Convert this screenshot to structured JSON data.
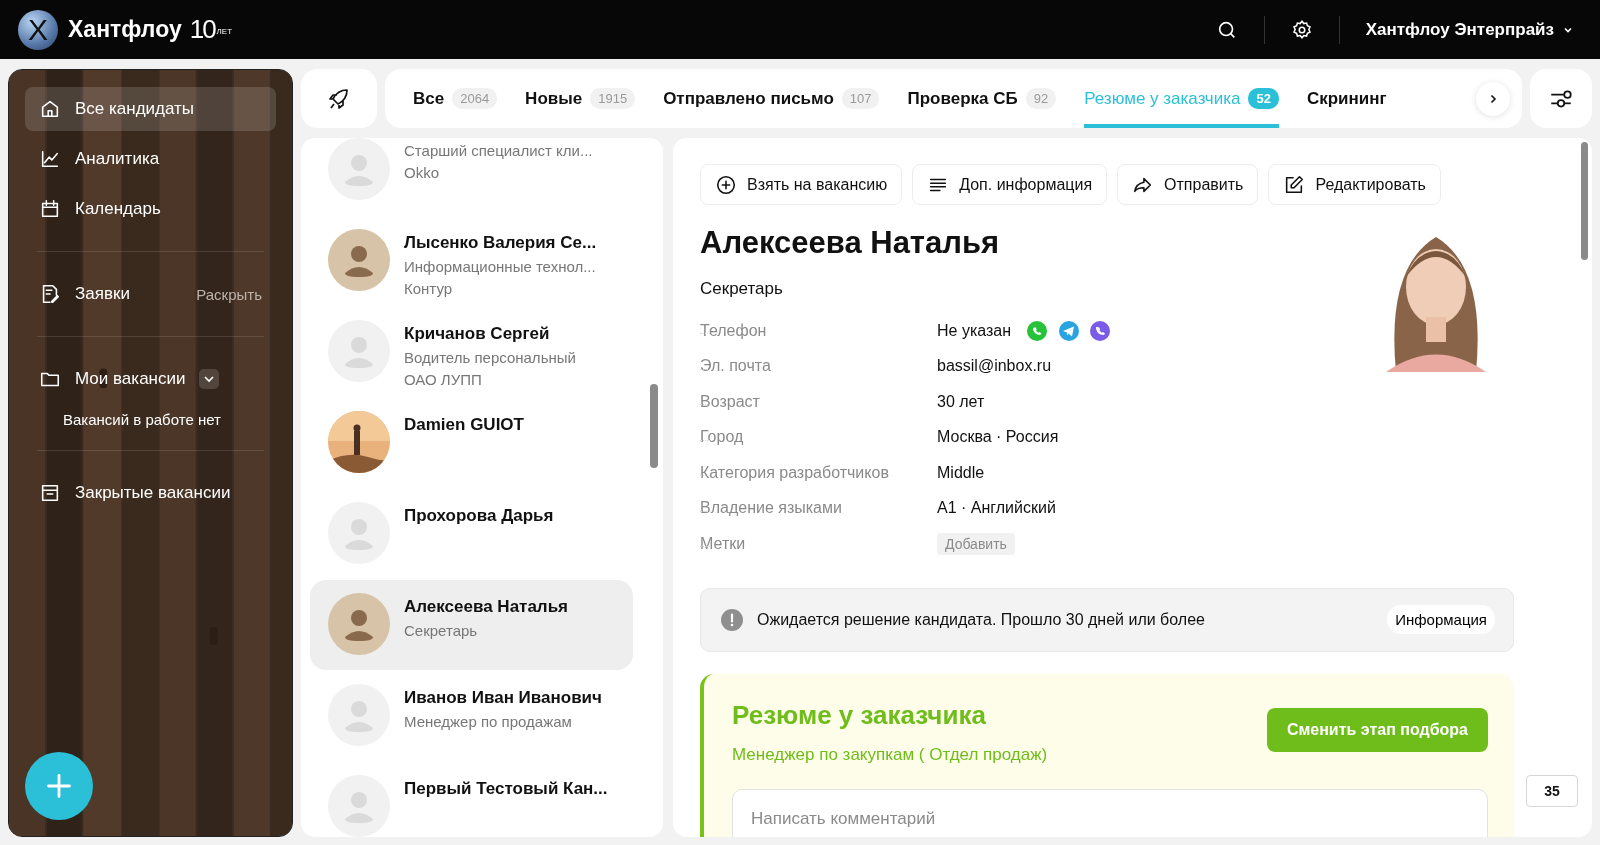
{
  "header": {
    "logo_mark": "X",
    "logo": "Хантфлоу",
    "anniversary_number": "10",
    "anniversary_word": "ЛЕТ",
    "account": "Хантфлоу Энтерпрайз"
  },
  "sidebar": {
    "items": [
      {
        "kind": "nav",
        "label": "Все кандидаты",
        "selected": true
      },
      {
        "kind": "nav",
        "label": "Аналитика",
        "selected": false
      },
      {
        "kind": "nav",
        "label": "Календарь",
        "selected": false
      },
      {
        "kind": "divider"
      },
      {
        "kind": "expandable",
        "label": "Заявки",
        "action": "Раскрыть",
        "selected": false
      },
      {
        "kind": "divider"
      },
      {
        "kind": "dropdown",
        "label": "Мои вакансии",
        "note": "Вакансий в работе нет",
        "selected": false
      },
      {
        "kind": "divider"
      },
      {
        "kind": "nav",
        "label": "Закрытые вакансии",
        "selected": false
      }
    ]
  },
  "tabs": [
    {
      "label": "Все",
      "count": "2064",
      "selected": false
    },
    {
      "label": "Новые",
      "count": "1915",
      "selected": false
    },
    {
      "label": "Отправлено письмо",
      "count": "107",
      "selected": false
    },
    {
      "label": "Проверка СБ",
      "count": "92",
      "selected": false
    },
    {
      "label": "Резюме у заказчика",
      "count": "52",
      "selected": true
    },
    {
      "label": "Скрининг",
      "selected": false
    }
  ],
  "candidates": [
    {
      "kind": "placeholder",
      "lines": [
        "Старший специалист кли...",
        "Okko"
      ],
      "selected": false
    },
    {
      "name": "Лысенко Валерия Се...",
      "lines": [
        "Информационные технол...",
        "Контур"
      ],
      "selected": false
    },
    {
      "kind": "placeholder",
      "name": "Кричанов Сергей",
      "lines": [
        "Водитель персональный",
        "ОАО ЛУПП"
      ],
      "selected": false
    },
    {
      "kind": "picture",
      "name": "Damien GUIOT",
      "selected": false
    },
    {
      "kind": "placeholder",
      "name": "Прохорова Дарья",
      "selected": false
    },
    {
      "name": "Алексеева Наталья",
      "lines": [
        "Секретарь"
      ],
      "selected": true
    },
    {
      "kind": "placeholder",
      "name": "Иванов Иван Иванович",
      "lines": [
        "Менеджер по продажам"
      ],
      "selected": false
    },
    {
      "kind": "placeholder",
      "name": "Первый Тестовый Кан...",
      "selected": false
    }
  ],
  "profile": {
    "actions": [
      "Взять на вакансию",
      "Доп. информация",
      "Отправить",
      "Редактировать"
    ],
    "name": "Алексеева Наталья",
    "position": "Секретарь",
    "fields": [
      {
        "kind": "phone",
        "label": "Телефон",
        "value": "Не указан"
      },
      {
        "kind": "text",
        "label": "Эл. почта",
        "value": "bassil@inbox.ru"
      },
      {
        "kind": "text",
        "label": "Возраст",
        "value": "30 лет"
      },
      {
        "kind": "text",
        "label": "Город",
        "value": "Москва · Россия"
      },
      {
        "kind": "text",
        "label": "Категория разработчиков",
        "value": "Middle"
      },
      {
        "kind": "text",
        "label": "Владение языками",
        "value": "A1 · Английский"
      },
      {
        "kind": "tags",
        "label": "Метки",
        "value": "Добавить"
      }
    ],
    "notice": {
      "text": "Ожидается решение кандидата. Прошло 30 дней или более",
      "button": "Информация"
    },
    "stage": {
      "title": "Резюме у заказчика",
      "vacancy": "Менеджер по закупкам ( Отдел продаж)",
      "button": "Сменить этап подбора",
      "comment_placeholder": "Написать комментарий"
    },
    "comment_count": "35"
  }
}
